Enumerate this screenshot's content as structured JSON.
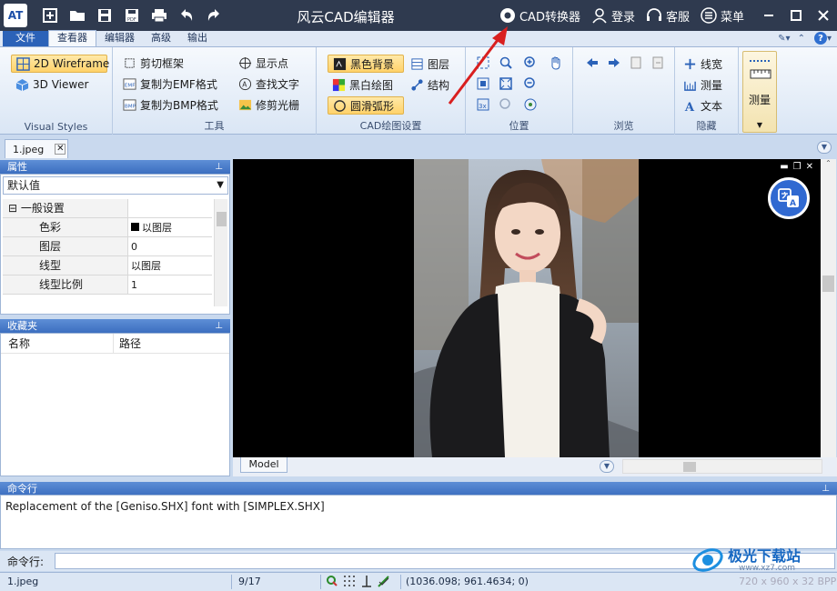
{
  "titlebar": {
    "logo": "AT",
    "title": "风云CAD编辑器",
    "converter": "CAD转换器",
    "login": "登录",
    "service": "客服",
    "menu": "菜单"
  },
  "ribbon_tabs": [
    "文件",
    "查看器",
    "编辑器",
    "高级",
    "输出"
  ],
  "ribbon": {
    "visual_styles": {
      "label": "Visual Styles",
      "wireframe": "2D Wireframe",
      "viewer3d": "3D Viewer"
    },
    "tools": {
      "label": "工具",
      "clip": "剪切框架",
      "copy_emf": "复制为EMF格式",
      "copy_bmp": "复制为BMP格式",
      "show_points": "显示点",
      "find_text": "查找文字",
      "trim_raster": "修剪光栅"
    },
    "cad_draw": {
      "label": "CAD绘图设置",
      "black_bg": "黑色背景",
      "bw_draw": "黑白绘图",
      "smooth_arc": "圆滑弧形",
      "layers": "图层",
      "structure": "结构"
    },
    "position": {
      "label": "位置"
    },
    "browse": {
      "label": "浏览"
    },
    "hide": {
      "label": "隐藏",
      "linewidth": "线宽",
      "measure": "测量",
      "text": "文本"
    },
    "measure_big": "测量"
  },
  "doc_tab": "1.jpeg",
  "properties": {
    "header": "属性",
    "preset": "默认值",
    "category": "一般设置",
    "rows": [
      {
        "key": "色彩",
        "value": "以图层"
      },
      {
        "key": "图层",
        "value": "0"
      },
      {
        "key": "线型",
        "value": "以图层"
      },
      {
        "key": "线型比例",
        "value": "1"
      }
    ]
  },
  "favorites": {
    "header": "收藏夹",
    "col_name": "名称",
    "col_path": "路径"
  },
  "model_tab": "Model",
  "command": {
    "header": "命令行",
    "log": "Replacement of the [Geniso.SHX] font with [SIMPLEX.SHX]",
    "input_label": "命令行:"
  },
  "status": {
    "file": "1.jpeg",
    "page": "9/17",
    "coords": "(1036.098; 961.4634; 0)",
    "size": "720 x 960 x 32 BPP"
  },
  "watermark": {
    "text": "极光下载站",
    "url": "www.xz7.com"
  },
  "colors": {
    "titlebar": "#2f3a4f",
    "accent": "#2b62b8",
    "highlight": "#ffd26a",
    "arrow": "#d91f1f"
  }
}
